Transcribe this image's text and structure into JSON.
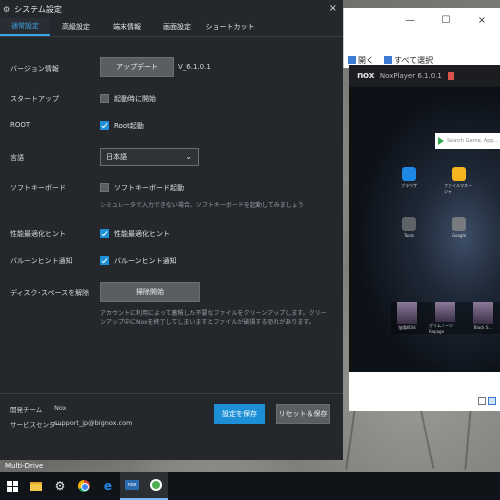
{
  "dialog": {
    "title": "システム設定",
    "close_glyph": "×",
    "tabs": [
      {
        "label": "通常設定",
        "active": true
      },
      {
        "label": "高級設定",
        "active": false
      },
      {
        "label": "端末情報",
        "active": false
      },
      {
        "label": "画面設定",
        "active": false
      },
      {
        "label": "ショートカット",
        "active": false
      }
    ],
    "settings": {
      "version_label": "バージョン情報",
      "update_button": "アップデート",
      "version_value": "V_6.1.0.1",
      "startup_label": "スタートアップ",
      "startup_checkbox": {
        "label": "起動時に開始",
        "checked": false
      },
      "root_label": "ROOT",
      "root_checkbox": {
        "label": "Root起動",
        "checked": true
      },
      "language_label": "言語",
      "language_value": "日本語",
      "softkeyboard_label": "ソフトキーボード",
      "softkeyboard_checkbox": {
        "label": "ソフトキーボード起動",
        "checked": false
      },
      "softkeyboard_hint": "シミュレータで入力できない場合、ソフトキーボードを起動してみましょう",
      "perf_label": "性能最適化ヒント",
      "perf_checkbox": {
        "label": "性能最適化ヒント",
        "checked": true
      },
      "balloon_label": "バルーンヒント通知",
      "balloon_checkbox": {
        "label": "バルーンヒント通知",
        "checked": true
      },
      "disk_label": "ディスク･スペースを解除",
      "disk_button": "掃除開始",
      "disk_hint": "アカウントに利用によって蓄積した不要なファイルをクリーンアップします。クリーンアップ中にNoxを終了してしまいますとファイルが破損する恐れがあります。"
    },
    "footer": {
      "team_label": "開発チーム",
      "team_value": "Nox",
      "support_label": "サービスセンター",
      "support_value": "support_jp@bignox.com",
      "save_button": "設定を保存",
      "reset_button": "リセット＆保存"
    }
  },
  "explorer": {
    "minimize": "—",
    "maximize": "☐",
    "close": "×",
    "ribbon_open": "開く",
    "ribbon_select_all": "すべて選択"
  },
  "nox": {
    "logo": "nox",
    "version": "NoxPlayer 6.1.0.1",
    "search_placeholder": "Search Game, App...",
    "apps": [
      {
        "label": "ブラウザ",
        "color": "#1e88e5"
      },
      {
        "label": "ファイルマネージャ",
        "color": "#f5b51e"
      },
      {
        "label": "Tools",
        "color": "#5f6368"
      },
      {
        "label": "Google",
        "color": "#777b80"
      }
    ],
    "dock": [
      {
        "label": "陰陽師3d"
      },
      {
        "label": "グリムノーツ Repage"
      },
      {
        "label": "Black S..."
      }
    ]
  },
  "desktop": {
    "label": "Multi-Drive"
  },
  "taskbar": {
    "items": [
      "windows-start",
      "file-explorer",
      "settings",
      "chrome",
      "internet-explorer",
      "nox",
      "multi-drive"
    ]
  }
}
